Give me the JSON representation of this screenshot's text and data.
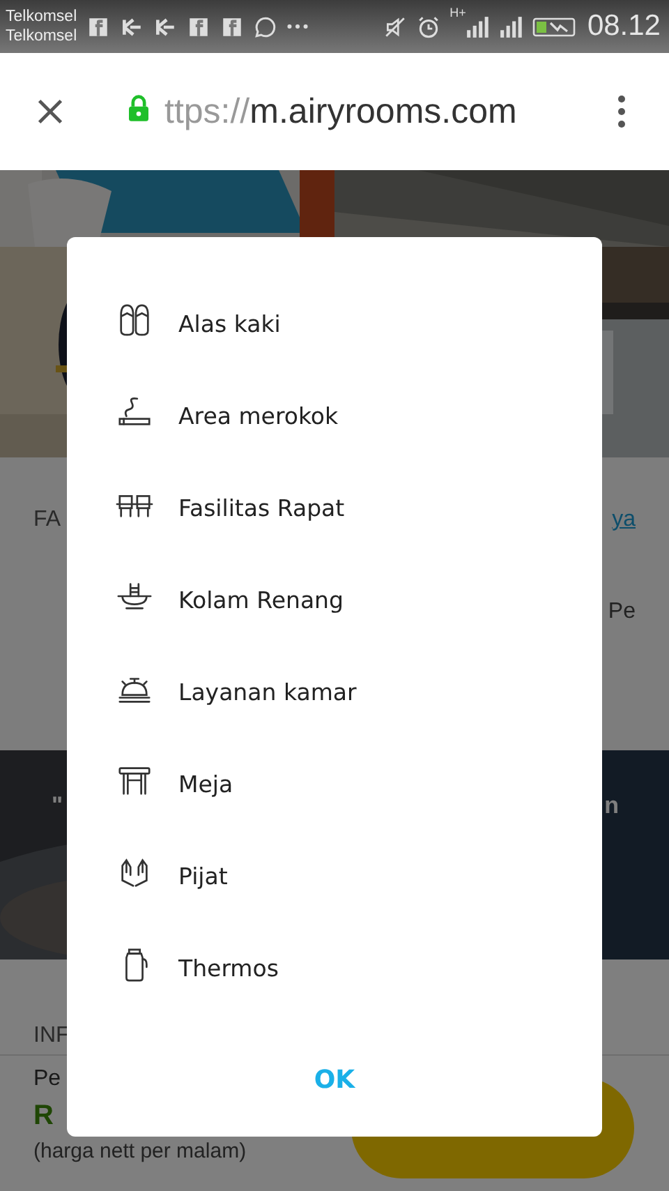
{
  "status_bar": {
    "carriers": [
      "Telkomsel",
      "Telkomsel"
    ],
    "network_type": "H+",
    "time": "08.12"
  },
  "browser": {
    "url_scheme": "ttps://",
    "url_host": "m.airyrooms.com"
  },
  "page": {
    "facilities_heading": "FA",
    "see_all_link": "ya",
    "right_text": "Pe",
    "quote_left": "\"",
    "quote_right": "n",
    "info_heading": "INF",
    "booking_label": "Pe",
    "price": "R",
    "price_note": "(harga nett per malam)"
  },
  "dialog": {
    "items": [
      {
        "label": "Alas kaki",
        "kind": "sandals"
      },
      {
        "label": "Area merokok",
        "kind": "smoking"
      },
      {
        "label": "Fasilitas Rapat",
        "kind": "meeting"
      },
      {
        "label": "Kolam Renang",
        "kind": "pool"
      },
      {
        "label": "Layanan kamar",
        "kind": "bell"
      },
      {
        "label": "Meja",
        "kind": "table"
      },
      {
        "label": "Pijat",
        "kind": "hands"
      },
      {
        "label": "Thermos",
        "kind": "thermos"
      }
    ],
    "button": "OK"
  }
}
